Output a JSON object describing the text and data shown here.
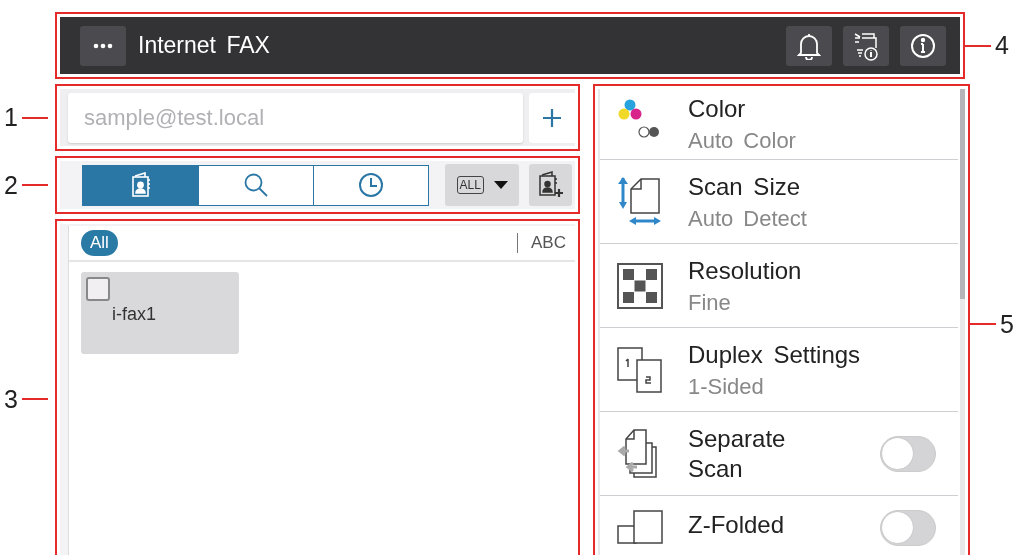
{
  "header": {
    "title": "Internet FAX"
  },
  "address_field": {
    "placeholder": "sample@test.local"
  },
  "tabs": [
    {
      "kind": "address-book",
      "selected": true
    },
    {
      "kind": "search",
      "selected": false
    },
    {
      "kind": "history",
      "selected": false
    }
  ],
  "filter_dropdown": {
    "label": "ALL"
  },
  "index": [
    {
      "label": "All",
      "selected": true
    },
    {
      "label": "ABC",
      "selected": false
    }
  ],
  "destinations": [
    {
      "name": "i-fax1",
      "checked": false
    }
  ],
  "settings": [
    {
      "kind": "value",
      "title": "Color",
      "value": "Auto Color"
    },
    {
      "kind": "value",
      "title": "Scan Size",
      "value": "Auto Detect"
    },
    {
      "kind": "value",
      "title": "Resolution",
      "value": "Fine"
    },
    {
      "kind": "value",
      "title": "Duplex Settings",
      "value": "1-Sided"
    },
    {
      "kind": "toggle",
      "title": "Separate Scan",
      "on": false
    },
    {
      "kind": "toggle",
      "title": "Z-Folded",
      "on": false
    }
  ],
  "callouts": [
    "1",
    "2",
    "3",
    "4",
    "5"
  ]
}
